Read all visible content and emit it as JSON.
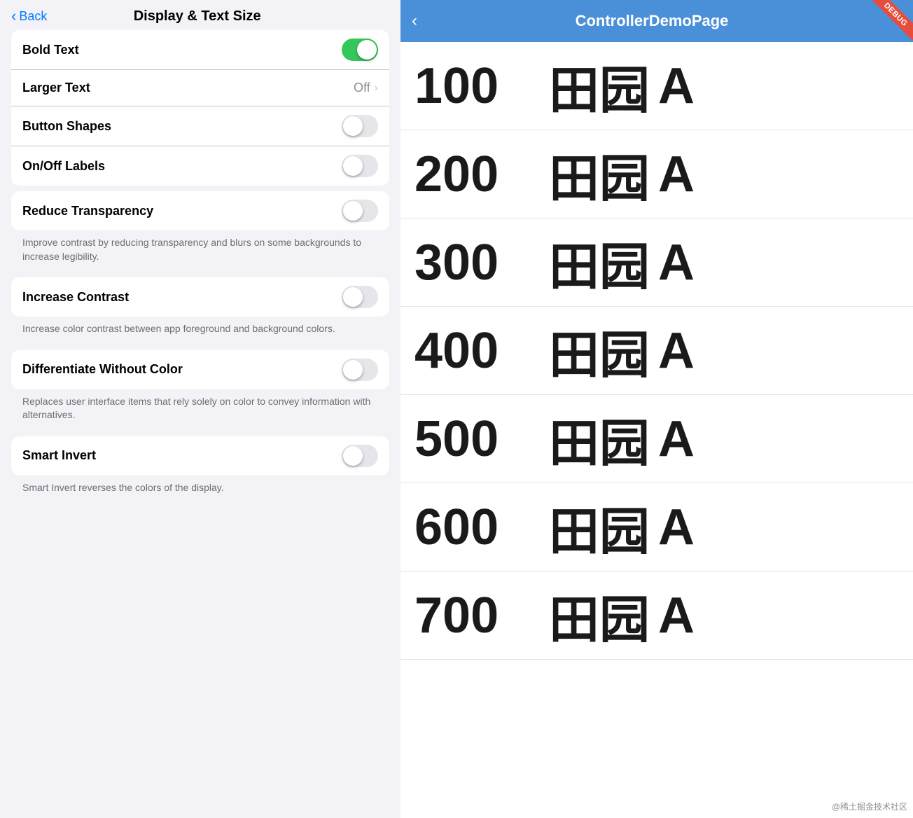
{
  "left": {
    "back_label": "Back",
    "title": "Display & Text Size",
    "settings": [
      {
        "id": "bold-text",
        "label": "Bold Text",
        "type": "toggle",
        "value": true,
        "description": null
      },
      {
        "id": "larger-text",
        "label": "Larger Text",
        "type": "link",
        "value": "Off",
        "description": null
      },
      {
        "id": "button-shapes",
        "label": "Button Shapes",
        "type": "toggle",
        "value": false,
        "description": null
      },
      {
        "id": "on-off-labels",
        "label": "On/Off Labels",
        "type": "toggle",
        "value": false,
        "description": null
      }
    ],
    "sections_with_desc": [
      {
        "id": "reduce-transparency",
        "label": "Reduce Transparency",
        "type": "toggle",
        "value": false,
        "description": "Improve contrast by reducing transparency and blurs on some backgrounds to increase legibility."
      },
      {
        "id": "increase-contrast",
        "label": "Increase Contrast",
        "type": "toggle",
        "value": false,
        "description": "Increase color contrast between app foreground and background colors."
      },
      {
        "id": "differentiate-without-color",
        "label": "Differentiate Without Color",
        "type": "toggle",
        "value": false,
        "description": "Replaces user interface items that rely solely on color to convey information with alternatives."
      },
      {
        "id": "smart-invert",
        "label": "Smart Invert",
        "type": "toggle",
        "value": false,
        "description": "Smart Invert reverses the colors of the display."
      }
    ]
  },
  "right": {
    "back_label": "",
    "title": "ControllerDemoPage",
    "debug_badge": "DEBUG",
    "font_sizes": [
      {
        "size": "100",
        "chinese": "田园",
        "letter": "A"
      },
      {
        "size": "200",
        "chinese": "田园",
        "letter": "A"
      },
      {
        "size": "300",
        "chinese": "田园",
        "letter": "A"
      },
      {
        "size": "400",
        "chinese": "田园",
        "letter": "A"
      },
      {
        "size": "500",
        "chinese": "田园",
        "letter": "A"
      },
      {
        "size": "600",
        "chinese": "田园",
        "letter": "A"
      },
      {
        "size": "700",
        "chinese": "田园",
        "letter": "A"
      }
    ],
    "watermark": "@稀土掘金技术社区"
  }
}
